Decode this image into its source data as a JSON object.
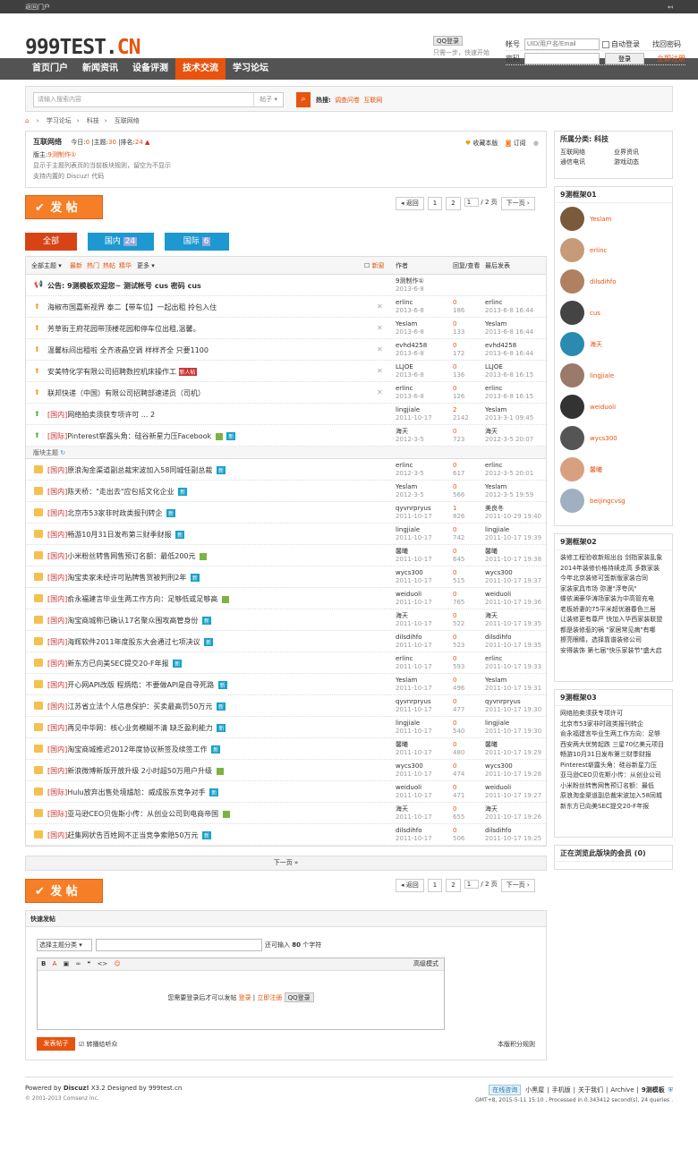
{
  "topbar": {
    "left": "返回门户",
    "right": "↤"
  },
  "logo": {
    "main": "999TEST.",
    "cn": "CN"
  },
  "qq": {
    "btn": "QQ登录",
    "sub": "只需一步，快速开始"
  },
  "login": {
    "user_label": "帐号",
    "user_placeholder": "UID/用户名/Email",
    "auto": "自动登录",
    "forgot": "找回密码",
    "pass_label": "密码",
    "login_btn": "登录",
    "register": "立即注册"
  },
  "nav": [
    "首页门户",
    "新闻资讯",
    "设备评测",
    "技术交流",
    "学习论坛"
  ],
  "search": {
    "placeholder": "请输入搜索内容",
    "type": "帖子",
    "hot_label": "热搜:",
    "hot": [
      "调查问卷",
      "互联网"
    ]
  },
  "crumb": [
    "学习论坛",
    "科技",
    "互联网络"
  ],
  "forum": {
    "name": "互联网络",
    "today_l": "今日:",
    "today": "0",
    "topics_l": "主题:",
    "topics": "30",
    "rank_l": "排名:",
    "rank": "24",
    "mod_l": "版主:",
    "mod": "9测制作①",
    "note1": "显示于主题列表页的当前板块规则，留空为不显示",
    "note2": "支持内置的 Discuz! 代码",
    "fav": "收藏本版",
    "sub": "订阅"
  },
  "post_btn": "发 帖",
  "pager": {
    "back": "返回",
    "p1": "1",
    "p2": "2",
    "cur": "1",
    "total": "/ 2 页",
    "next": "下一页"
  },
  "tabs": {
    "all": "全部",
    "dom": "国内",
    "dom_n": "24",
    "intl": "国际",
    "intl_n": "6"
  },
  "lhead": {
    "all": "全部主题",
    "f1": "最新",
    "f2": "热门",
    "f3": "热帖",
    "f4": "精华",
    "more": "更多",
    "newwin": "新窗",
    "author": "作者",
    "reply": "回复/查看",
    "last": "最后发表"
  },
  "announce": {
    "title": "公告: 9测模板欢迎您~ 测试帐号 cus 密码  cus",
    "author": "9测制作①",
    "date": "2013-6-8"
  },
  "sticky": [
    {
      "t": "海椒市国嘉新视界 泰二【带车位】一起出租 拎包入住",
      "a": "erlinc",
      "d": "2013-6-8",
      "r": "0",
      "v": "186",
      "l": "erlinc",
      "ld": "2013-6-8 16:44"
    },
    {
      "t": "芳草街王府花园带顶楼花园和停车位出租,温馨。",
      "a": "Yeslam",
      "d": "2013-6-8",
      "r": "0",
      "v": "133",
      "l": "Yeslam",
      "ld": "2013-6-8 16:44"
    },
    {
      "t": "温馨标间出租啦 全齐液晶空调 样样齐全 只要1100",
      "a": "evhd4258",
      "d": "2013-6-8",
      "r": "0",
      "v": "172",
      "l": "evhd4258",
      "ld": "2013-6-8 16:44"
    },
    {
      "t": "安美特化学有限公司招聘数控机床操作工",
      "tag": "新人帖",
      "a": "LLJOE",
      "d": "2013-6-8",
      "r": "0",
      "v": "136",
      "l": "LLJOE",
      "ld": "2013-6-8 16:15"
    },
    {
      "t": "联邦快递（中国）有限公司招聘部速递员（司机）",
      "a": "erlinc",
      "d": "2013-6-8",
      "r": "0",
      "v": "126",
      "l": "erlinc",
      "ld": "2013-6-8 16:15"
    },
    {
      "c": "[国内]",
      "t": "网络拍卖须获专项许可  ... 2",
      "a": "lingjiale",
      "d": "2011-10-17",
      "r": "2",
      "v": "2142",
      "l": "Yeslam",
      "ld": "2013-3-1 09:45"
    },
    {
      "c": "[国际]",
      "t": "Pinterest崭露头角：硅谷新星力压Facebook",
      "a": "海天",
      "d": "2012-3-5",
      "r": "0",
      "v": "723",
      "l": "海天",
      "ld": "2012-3-5 20:07"
    }
  ],
  "section": "版块主题",
  "threads": [
    {
      "c": "[国内]",
      "t": "原浪淘金渠道副总裁宋波加入58同城任副总裁",
      "a": "erlinc",
      "d": "2012-3-5",
      "r": "0",
      "v": "617",
      "l": "erlinc",
      "ld": "2012-3-5 20:01"
    },
    {
      "c": "[国内]",
      "t": "陈天桥：\"走出去\"应包括文化企业",
      "a": "Yeslam",
      "d": "2012-3-5",
      "r": "0",
      "v": "566",
      "l": "Yeslam",
      "ld": "2012-3-5 19:59"
    },
    {
      "c": "[国内]",
      "t": "北京市53家非时政类报刊转企",
      "a": "qyvnrpryus",
      "d": "2011-10-17",
      "r": "1",
      "v": "826",
      "l": "美良冬",
      "ld": "2011-10-29 19:40"
    },
    {
      "c": "[国内]",
      "t": "畅游10月31日发布第三财季财报",
      "a": "lingjiale",
      "d": "2011-10-17",
      "r": "0",
      "v": "742",
      "l": "lingjiale",
      "ld": "2011-10-17 19:39"
    },
    {
      "c": "[国内]",
      "t": "小米粉丝转售网售预订名额：最低200元",
      "a": "馨曦",
      "d": "2011-10-17",
      "r": "0",
      "v": "645",
      "l": "馨曦",
      "ld": "2011-10-17 19:38"
    },
    {
      "c": "[国内]",
      "t": "淘宝卖家未经许可贴牌售货被判刑2年",
      "a": "wycs300",
      "d": "2011-10-17",
      "r": "0",
      "v": "515",
      "l": "wycs300",
      "ld": "2011-10-17 19:37"
    },
    {
      "c": "[国内]",
      "t": "俞永福建言毕业生两工作方向：足够低或足够高",
      "a": "weiduoli",
      "d": "2011-10-17",
      "r": "0",
      "v": "765",
      "l": "weiduoli",
      "ld": "2011-10-17 19:36"
    },
    {
      "c": "[国内]",
      "t": "淘宝商城称已确认17名聚众围攻高管身份",
      "a": "海天",
      "d": "2011-10-17",
      "r": "0",
      "v": "522",
      "l": "海天",
      "ld": "2011-10-17 19:35"
    },
    {
      "c": "[国内]",
      "t": "海辉软件2011年度股东大会通过七项决议",
      "a": "dilsdihfo",
      "d": "2011-10-17",
      "r": "0",
      "v": "523",
      "l": "dilsdihfo",
      "ld": "2011-10-17 19:35"
    },
    {
      "c": "[国内]",
      "t": "新东方已向美SEC提交20-F年报",
      "a": "erlinc",
      "d": "2011-10-17",
      "r": "0",
      "v": "593",
      "l": "erlinc",
      "ld": "2011-10-17 19:33"
    },
    {
      "c": "[国内]",
      "t": "开心网API改版 程炳皓：不要做API是自寻死路",
      "a": "Yeslam",
      "d": "2011-10-17",
      "r": "0",
      "v": "496",
      "l": "Yeslam",
      "ld": "2011-10-17 19:31"
    },
    {
      "c": "[国内]",
      "t": "江苏省立法个人信息保护：买卖最高罚50万元",
      "a": "qyvnrpryus",
      "d": "2011-10-17",
      "r": "0",
      "v": "477",
      "l": "qyvnrpryus",
      "ld": "2011-10-17 19:30"
    },
    {
      "c": "[国内]",
      "t": "再见中华网：核心业务模糊不清 缺乏盈利能力",
      "a": "lingjiale",
      "d": "2011-10-17",
      "r": "0",
      "v": "540",
      "l": "lingjiale",
      "ld": "2011-10-17 19:30"
    },
    {
      "c": "[国内]",
      "t": "淘宝商城推迟2012年度协议新签及续签工作",
      "a": "馨曦",
      "d": "2011-10-17",
      "r": "0",
      "v": "480",
      "l": "馨曦",
      "ld": "2011-10-17 19:29"
    },
    {
      "c": "[国内]",
      "t": "新浪微博新版开放升级 2小时超50万用户升级",
      "a": "wycs300",
      "d": "2011-10-17",
      "r": "0",
      "v": "474",
      "l": "wycs300",
      "ld": "2011-10-17 19:28"
    },
    {
      "c": "[国际]",
      "t": "Hulu放弃出售处境尴尬：威成股东竞争对手",
      "a": "weiduoli",
      "d": "2011-10-17",
      "r": "0",
      "v": "471",
      "l": "weiduoli",
      "ld": "2011-10-17 19:27"
    },
    {
      "c": "[国际]",
      "t": "亚马逊CEO贝佐斯小传：从创业公司到电商帝国",
      "a": "海天",
      "d": "2011-10-17",
      "r": "0",
      "v": "655",
      "l": "海天",
      "ld": "2011-10-17 19:26"
    },
    {
      "c": "[国内]",
      "t": "赶集网状告百姓网不正当竞争索赔50万元",
      "a": "dilsdihfo",
      "d": "2011-10-17",
      "r": "0",
      "v": "506",
      "l": "dilsdihfo",
      "ld": "2011-10-17 19:25"
    }
  ],
  "next_page": "下一页 »",
  "quick": {
    "title": "快速发帖",
    "select": "选择主题分类",
    "limit_pre": "还可输入",
    "limit_n": "80",
    "limit_suf": "个字符",
    "adv": "高级模式",
    "need": "您需要登录后才可以发帖",
    "login": "登录",
    "reg": "立即注册",
    "qq": "QQ登录",
    "submit": "发表帖子",
    "share": "转播给听众",
    "rule": "本版积分规则"
  },
  "side": {
    "cat_title": "所属分类: 科技",
    "cats": [
      "互联网络",
      "业界资讯",
      "通信电讯",
      "游戏动态"
    ],
    "b1": "9测框架01",
    "users": [
      "Yeslam",
      "erlinc",
      "dilsdihfo",
      "cus",
      "海天",
      "lingjiale",
      "weiduoli",
      "wycs300",
      "馨曦",
      "beijingcvsg"
    ],
    "b2": "9测框架02",
    "b2_lines": [
      "装修工程验收新规出台 剑指家装乱象",
      "2014年装修价格持续走高 多数家装",
      "今年北京装修可签新版家装合同",
      "家装家具市场 弥漫\"浮夸风\"",
      "蝶依澜豪华涛场家装为中高管充电",
      "老板娇妻的75平米超优雅春色三居",
      "让装修更有尊严 快加入华西家装联盟",
      "都是装修惹的祸 \"家居常见病\"有哪",
      "擦亮眼睛，选择靠谱装修公司",
      "安得装饰 第七届\"快乐家装节\"盛大启"
    ],
    "b3": "9测框架03",
    "b3_lines": [
      "网络拍卖须获专项许可",
      "北京市53家非时政类报刊转企",
      "俞永福建言毕业生两工作方向：足够",
      "西安两大优势起跌 三星70亿美元项目",
      "畅游10月31日发布第三财季财报",
      "Pinterest崭露头角：硅谷新星力压",
      "亚马逊CEO贝佐斯小传：从创业公司",
      "小米粉丝转售网售预订名额：最低",
      "原浪淘金渠道副总裁宋波加入58同城",
      "新东方已向美SEC提交20-F年报"
    ],
    "online": "正在浏览此版块的会员 (0)"
  },
  "footer": {
    "powered": "Powered by",
    "dz": "Discuz!",
    "ver": "X3.2",
    "designed": "Designed by",
    "site": "999test.cn",
    "copy": "© 2001-2013 Comsenz Inc.",
    "online_btn": "在线咨询",
    "links": [
      "小黑屋",
      "手机版",
      "关于我们",
      "Archive",
      "9测模板"
    ],
    "gmt": "GMT+8, 2015-5-11 15:10 , Processed in 0.343412 second(s), 24 queries ."
  }
}
